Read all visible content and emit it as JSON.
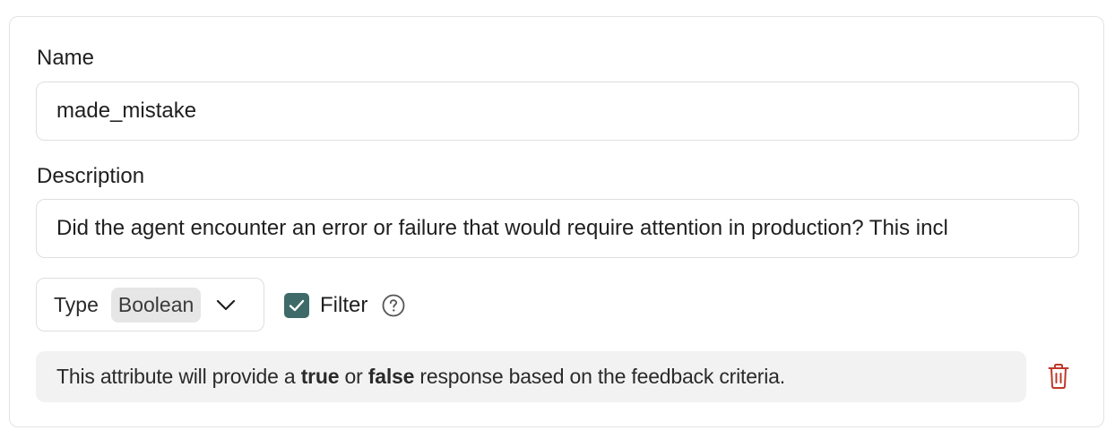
{
  "form": {
    "name_label": "Name",
    "name_value": "made_mistake",
    "description_label": "Description",
    "description_value": "Did the agent encounter an error or failure that would require attention in production? This incl",
    "type_label": "Type",
    "type_value": "Boolean",
    "filter_label": "Filter",
    "filter_checked": true,
    "info_prefix": "This attribute will provide a ",
    "info_true": "true",
    "info_or": " or ",
    "info_false": "false",
    "info_suffix": " response based on the feedback criteria."
  },
  "icons": {
    "chevron": "chevron-down-icon",
    "check": "check-icon",
    "help": "help-circle-icon",
    "delete": "trash-icon"
  },
  "colors": {
    "checkbox": "#3f6a6a",
    "danger": "#c0392b"
  }
}
